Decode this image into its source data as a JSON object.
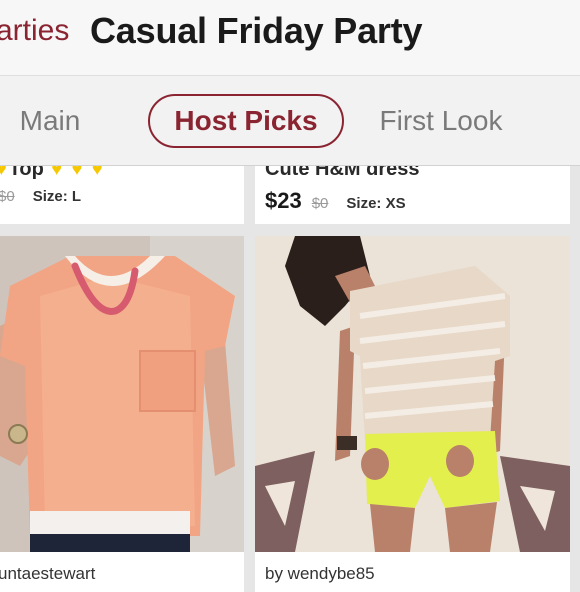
{
  "header": {
    "back_label": "arties",
    "title": "Casual Friday Party"
  },
  "tabs": [
    {
      "label": "Main"
    },
    {
      "label": "Host Picks"
    },
    {
      "label": "First Look"
    }
  ],
  "listings": [
    {
      "title": "Top",
      "price": "",
      "original_price": "$0",
      "size": "Size: L",
      "seller": "untaestewart"
    },
    {
      "title": "Cute H&M dress",
      "price": "$23",
      "original_price": "$0",
      "size": "Size: XS",
      "seller": "by wendybe85"
    }
  ],
  "colors": {
    "accent": "#8a2431",
    "heart": "#f5c800"
  }
}
